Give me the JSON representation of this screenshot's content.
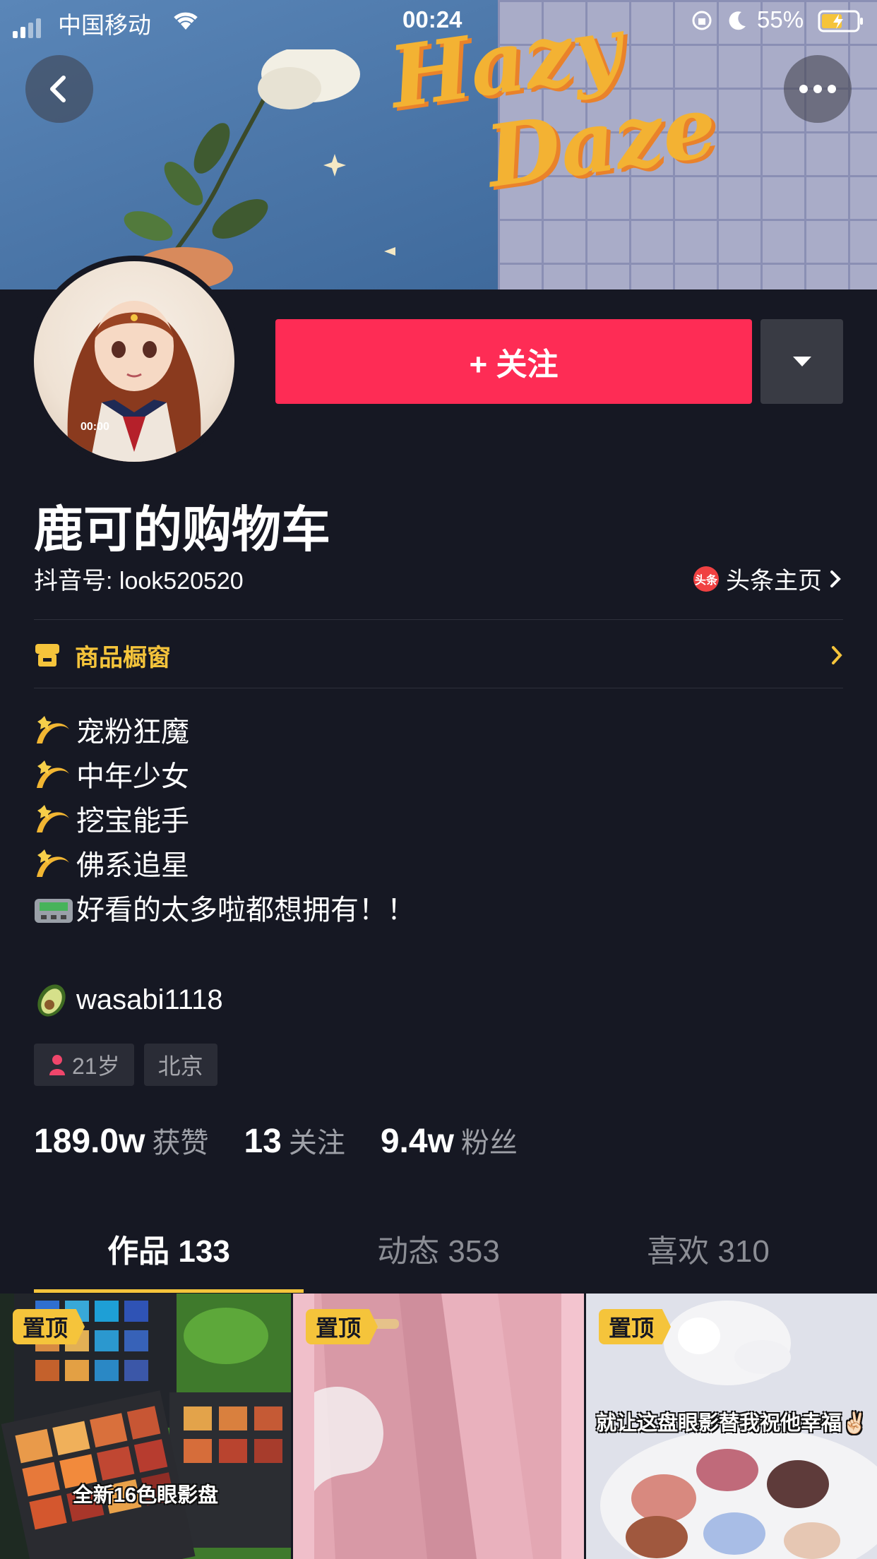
{
  "status_bar": {
    "carrier": "中国移动",
    "time": "00:24",
    "battery": "55%"
  },
  "cover": {
    "line1": "Hazy",
    "line2": "Daze"
  },
  "avatar": {
    "overlay_text": "00:00"
  },
  "header": {
    "follow_label": "+ 关注"
  },
  "profile": {
    "name": "鹿可的购物车",
    "douyin_id": "抖音号: look520520",
    "toutiao_label": "头条主页",
    "toutiao_badge": "头条"
  },
  "shop": {
    "label": "商品橱窗"
  },
  "bio": {
    "lines": [
      "宠粉狂魔",
      "中年少女",
      "挖宝能手",
      "佛系追星",
      "好看的太多啦都想拥有！！"
    ],
    "contact": "wasabi1118"
  },
  "tags": {
    "age": "21岁",
    "city": "北京"
  },
  "stats": {
    "likes_value": "189.0w",
    "likes_label": "获赞",
    "following_value": "13",
    "following_label": "关注",
    "fans_value": "9.4w",
    "fans_label": "粉丝"
  },
  "tabs": [
    {
      "label": "作品 133"
    },
    {
      "label": "动态 353"
    },
    {
      "label": "喜欢 310"
    }
  ],
  "videos": [
    {
      "pin": "置顶",
      "caption": "全新16色眼影盘"
    },
    {
      "pin": "置顶",
      "caption": ""
    },
    {
      "pin": "置顶",
      "caption": "就让这盘眼影替我祝他幸福✌🏻"
    }
  ],
  "colors": {
    "background": "#161823",
    "follow": "#fe2c55",
    "accent_yellow": "#f5c43b"
  }
}
